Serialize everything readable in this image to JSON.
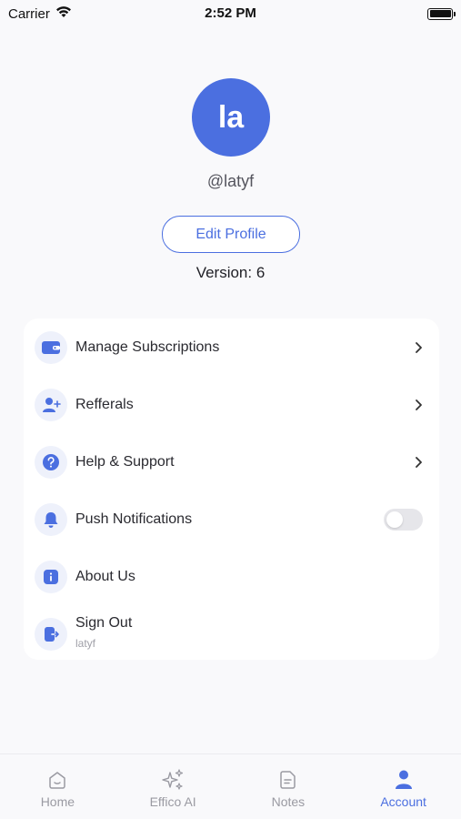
{
  "status_bar": {
    "carrier": "Carrier",
    "time": "2:52 PM"
  },
  "profile": {
    "avatar_initials": "la",
    "username": "@latyf",
    "edit_button": "Edit Profile",
    "version": "Version: 6"
  },
  "menu": {
    "items": [
      {
        "label": "Manage Subscriptions",
        "icon": "wallet-icon"
      },
      {
        "label": "Refferals",
        "icon": "add-user-icon"
      },
      {
        "label": "Help & Support",
        "icon": "help-icon"
      },
      {
        "label": "Push Notifications",
        "icon": "bell-icon",
        "toggle_on": false
      },
      {
        "label": "About Us",
        "icon": "info-icon"
      },
      {
        "label": "Sign Out",
        "sublabel": "latyf",
        "icon": "sign-out-icon"
      }
    ]
  },
  "tabs": [
    {
      "label": "Home",
      "icon": "home-icon",
      "active": false
    },
    {
      "label": "Effico AI",
      "icon": "sparkles-icon",
      "active": false
    },
    {
      "label": "Notes",
      "icon": "notes-icon",
      "active": false
    },
    {
      "label": "Account",
      "icon": "account-icon",
      "active": true
    }
  ],
  "colors": {
    "accent": "#4b6fe0",
    "icon_bg": "#eef1fb",
    "inactive_tab": "#9a9aa2"
  }
}
